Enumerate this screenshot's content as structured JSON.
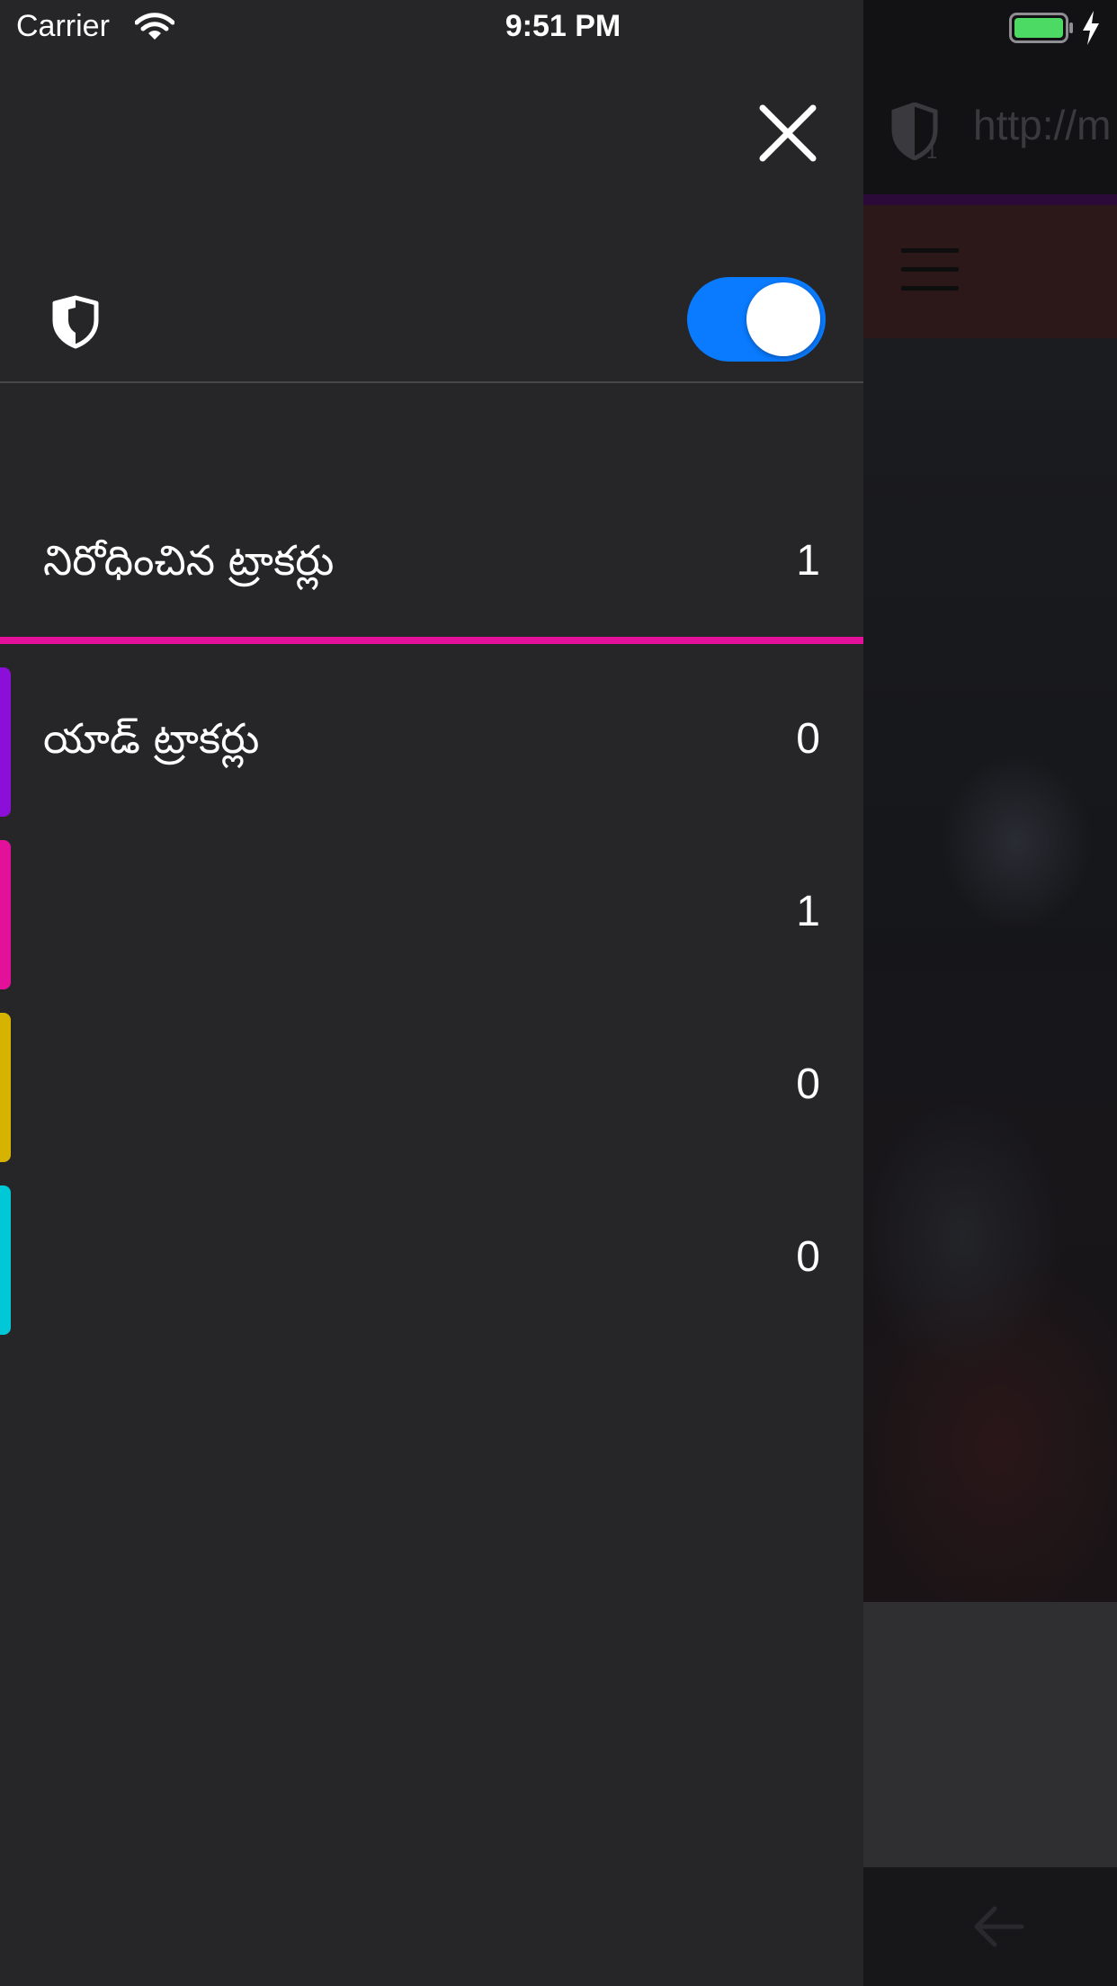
{
  "status_bar": {
    "carrier": "Carrier",
    "time": "9:51 PM",
    "battery_color": "#4cd964"
  },
  "background_page": {
    "url": "http://m",
    "tracker_badge_count": "1"
  },
  "tracking_panel": {
    "close_icon": "close-icon",
    "protection_toggle": {
      "on": true,
      "color": "#0a7afe"
    },
    "summary": {
      "label": "నిరోధించిన ట్రాకర్లు",
      "count": "1"
    },
    "divider_color": "#e3119a",
    "categories": [
      {
        "label": "యాడ్ ట్రాకర్లు",
        "count": "0",
        "color": "#8b0fd8"
      },
      {
        "label": "",
        "count": "1",
        "color": "#e3119a"
      },
      {
        "label": "",
        "count": "0",
        "color": "#d6b300"
      },
      {
        "label": "",
        "count": "0",
        "color": "#00c8d6"
      }
    ]
  }
}
